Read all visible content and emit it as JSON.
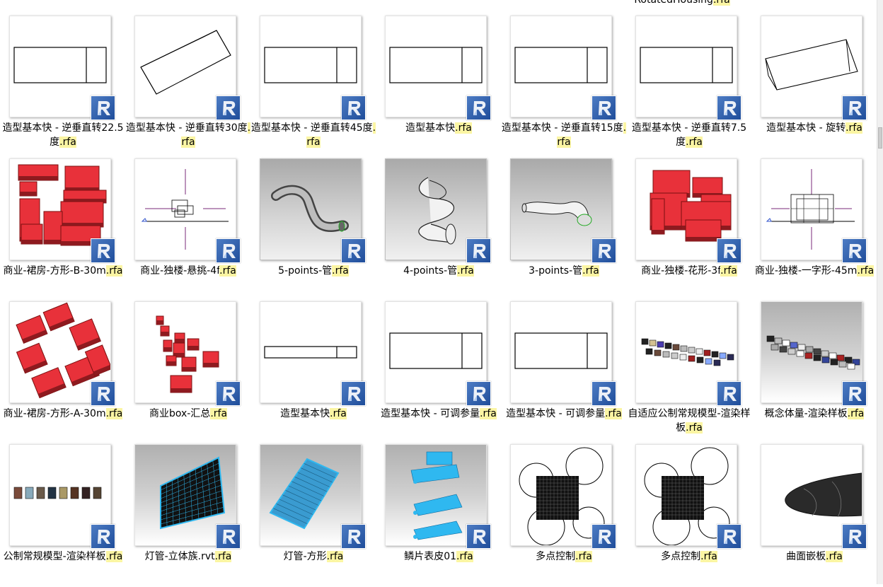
{
  "top_partial": {
    "name": "RotatedHousing",
    "ext": ".rfa"
  },
  "files": [
    {
      "name": "造型基本快 - 逆垂直转22.5度",
      "ext": ".rfa",
      "thumb": "rect-view"
    },
    {
      "name": "造型基本快 - 逆垂直转30度",
      "ext": ".rfa",
      "thumb": "box-rotated"
    },
    {
      "name": "造型基本快 - 逆垂直转45度",
      "ext": ".rfa",
      "thumb": "rect-view"
    },
    {
      "name": "造型基本快",
      "ext": ".rfa",
      "thumb": "rect-view"
    },
    {
      "name": "造型基本快 - 逆垂直转15度",
      "ext": ".rfa",
      "thumb": "rect-view"
    },
    {
      "name": "造型基本快 - 逆垂直转7.5度",
      "ext": ".rfa",
      "thumb": "rect-view"
    },
    {
      "name": "造型基本快 - 旋转",
      "ext": ".rfa",
      "thumb": "box-rotated-2"
    },
    {
      "name": "商业-裙房-方形-B-30m",
      "ext": ".rfa",
      "thumb": "red-blocks"
    },
    {
      "name": "商业-独楼-悬挑-4f",
      "ext": ".rfa",
      "thumb": "plan-cross"
    },
    {
      "name": "5-points-管",
      "ext": ".rfa",
      "thumb": "tube-5"
    },
    {
      "name": "4-points-管",
      "ext": ".rfa",
      "thumb": "tube-4"
    },
    {
      "name": "3-points-管",
      "ext": ".rfa",
      "thumb": "tube-3"
    },
    {
      "name": "商业-独楼-花形-3f",
      "ext": ".rfa",
      "thumb": "red-flower"
    },
    {
      "name": "商业-独楼-一字形-45m",
      "ext": ".rfa",
      "thumb": "plan-cross-2"
    },
    {
      "name": "商业-裙房-方形-A-30m",
      "ext": ".rfa",
      "thumb": "red-ring"
    },
    {
      "name": "商业box-汇总",
      "ext": ".rfa",
      "thumb": "red-scatter"
    },
    {
      "name": "造型基本快",
      "ext": ".rfa",
      "thumb": "rect-thin"
    },
    {
      "name": "造型基本快 - 可调参量",
      "ext": ".rfa",
      "thumb": "rect-view"
    },
    {
      "name": "造型基本快 - 可调参量",
      "ext": ".rfa",
      "thumb": "rect-view"
    },
    {
      "name": "自适应公制常规模型-渲染样板",
      "ext": ".rfa",
      "thumb": "cubes-row"
    },
    {
      "name": "概念体量-渲染样板",
      "ext": ".rfa",
      "thumb": "cubes-row-gray"
    },
    {
      "name": "公制常规模型-渲染样板",
      "ext": ".rfa",
      "thumb": "cubes-flat"
    },
    {
      "name": "灯管-立体族.rvt",
      "ext": ".rfa",
      "thumb": "grid-skew"
    },
    {
      "name": "灯管-方形",
      "ext": ".rfa",
      "thumb": "grid-skew-2"
    },
    {
      "name": "鳞片表皮01",
      "ext": ".rfa",
      "thumb": "layers"
    },
    {
      "name": "多点控制",
      "ext": ".rfa",
      "thumb": "circles-grid"
    },
    {
      "name": "多点控制",
      "ext": ".rfa",
      "thumb": "circles-grid"
    },
    {
      "name": "曲面嵌板",
      "ext": ".rfa",
      "thumb": "curved-panel"
    }
  ],
  "badge_icon": "revit-family-icon",
  "colors": {
    "highlight": "#fbf5a3",
    "badge": "#2b5aa8",
    "red_mass": "#e8313a",
    "tube_blue": "#2fb8f0"
  }
}
